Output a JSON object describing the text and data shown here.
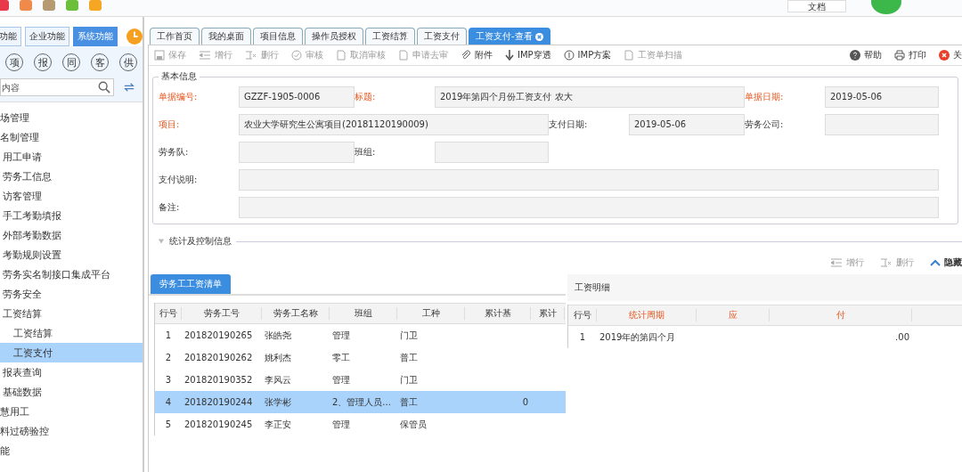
{
  "top_bar": {
    "app_icons": [
      {
        "color": "#e8394a"
      },
      {
        "color": "#f08a4b"
      },
      {
        "color": "#b59a72"
      },
      {
        "color": "#6cbf3a"
      },
      {
        "color": "#f5a623"
      }
    ],
    "doc_button": "文档"
  },
  "sidebar": {
    "tabs": [
      {
        "label": "功能",
        "selected": false
      },
      {
        "label": "企业功能",
        "selected": false
      },
      {
        "label": "系统功能",
        "selected": true
      }
    ],
    "quick_buttons": [
      "项",
      "报",
      "同",
      "客",
      "供"
    ],
    "search": {
      "placeholder": "内容"
    },
    "tree": [
      {
        "label": "场管理",
        "selected": false
      },
      {
        "label": "名制管理",
        "selected": false,
        "children": [
          {
            "label": "用工申请",
            "selected": false
          },
          {
            "label": "劳务工信息",
            "selected": false
          },
          {
            "label": "访客管理",
            "selected": false
          },
          {
            "label": "手工考勤填报",
            "selected": false
          },
          {
            "label": "外部考勤数据",
            "selected": false
          },
          {
            "label": "考勤规则设置",
            "selected": false
          },
          {
            "label": "劳务实名制接口集成平台",
            "selected": false
          },
          {
            "label": "劳务安全",
            "selected": false
          },
          {
            "label": "工资结算",
            "selected": false,
            "children": [
              {
                "label": "工资结算",
                "selected": false
              },
              {
                "label": "工资支付",
                "selected": true
              }
            ]
          },
          {
            "label": "报表查询",
            "selected": false
          },
          {
            "label": "基础数据",
            "selected": false
          }
        ]
      },
      {
        "label": "慧用工",
        "selected": false
      },
      {
        "label": "料过磅验控",
        "selected": false
      },
      {
        "label": "能",
        "selected": false
      }
    ]
  },
  "tabs": [
    {
      "label": "工作首页",
      "selected": false
    },
    {
      "label": "我的桌面",
      "selected": false
    },
    {
      "label": "项目信息",
      "selected": false
    },
    {
      "label": "操作员授权",
      "selected": false
    },
    {
      "label": "工资结算",
      "selected": false
    },
    {
      "label": "工资支付",
      "selected": false
    },
    {
      "label": "工资支付-查看",
      "selected": true,
      "closable": true
    }
  ],
  "toolbar": [
    {
      "kind": "save",
      "label": "保存",
      "disabled": true
    },
    {
      "kind": "add-row",
      "label": "增行",
      "disabled": true
    },
    {
      "kind": "delete-row",
      "label": "删行",
      "disabled": true
    },
    {
      "kind": "approve",
      "label": "审核",
      "disabled": true
    },
    {
      "kind": "document",
      "label": "取消审核",
      "disabled": true
    },
    {
      "kind": "document",
      "label": "申请去审",
      "disabled": true
    },
    {
      "kind": "attach",
      "label": "附件",
      "disabled": false
    },
    {
      "kind": "down",
      "label": "IMP穿透",
      "disabled": false
    },
    {
      "kind": "info",
      "label": "IMP方案",
      "disabled": false
    },
    {
      "kind": "document",
      "label": "工资单扫描",
      "disabled": true
    }
  ],
  "toolbar_right": [
    {
      "kind": "help",
      "label": "帮助"
    },
    {
      "kind": "print",
      "label": "打印"
    },
    {
      "kind": "close",
      "label": "关"
    }
  ],
  "basic_info": {
    "legend": "基本信息",
    "rows": [
      [
        {
          "label": "单据编号:",
          "value": "GZZF-1905-0006",
          "required": true
        },
        {
          "label": "标题:",
          "value": "2019年第四个月份工资支付   农大",
          "required": true
        },
        {
          "label": "单据日期:",
          "value": "2019-05-06",
          "required": true
        }
      ],
      [
        {
          "label": "项目:",
          "value": "农业大学研究生公寓项目(20181120190009)",
          "required": true
        },
        {
          "label": "支付日期:",
          "value": "2019-05-06",
          "required": false
        },
        {
          "label": "劳务公司:",
          "required": false
        }
      ],
      [
        {
          "label": "劳务队:",
          "required": false
        },
        {
          "label": "班组:",
          "required": false
        }
      ],
      [
        {
          "label": "支付说明:",
          "required": false
        }
      ],
      [
        {
          "label": "备注:",
          "required": false
        }
      ]
    ]
  },
  "stats_section": {
    "legend": "统计及控制信息",
    "expanded": false
  },
  "grid_buttons": [
    {
      "kind": "add-row",
      "label": "增行",
      "disabled": true
    },
    {
      "kind": "delete-row",
      "label": "删行",
      "disabled": true
    },
    {
      "kind": "hide",
      "label": "隐藏",
      "disabled": false
    }
  ],
  "wage_list": {
    "tab": "劳务工工资清单",
    "columns": [
      "行号",
      "劳务工号",
      "劳务工名称",
      "班组",
      "工种",
      "累计基",
      "累计"
    ],
    "rows": [
      {
        "row": "1",
        "worker_id": "201820190265",
        "name": "张皓尧",
        "team": "管理",
        "trade": "门卫",
        "selected": false
      },
      {
        "row": "2",
        "worker_id": "201820190262",
        "name": "姚利杰",
        "team": "零工",
        "trade": "普工",
        "selected": false
      },
      {
        "row": "3",
        "worker_id": "201820190352",
        "name": "李风云",
        "team": "管理",
        "trade": "门卫",
        "selected": false
      },
      {
        "row": "4",
        "worker_id": "201820190244",
        "name": "张学彬",
        "team": "2、管理人员...",
        "trade": "普工",
        "column_6": "0",
        "selected": true
      },
      {
        "row": "5",
        "worker_id": "201820190245",
        "name": "李正安",
        "team": "管理",
        "trade": "保管员",
        "selected": false
      }
    ]
  },
  "wage_detail": {
    "title": "工资明细",
    "columns": [
      {
        "label": "行号",
        "required": false
      },
      {
        "label": "统计周期",
        "required": true
      },
      {
        "label": "应",
        "required": true
      },
      {
        "label": "付",
        "required": true
      }
    ],
    "rows": [
      {
        "row": "1",
        "period": "2019年的第四个月",
        "column_4": ".00"
      }
    ]
  }
}
